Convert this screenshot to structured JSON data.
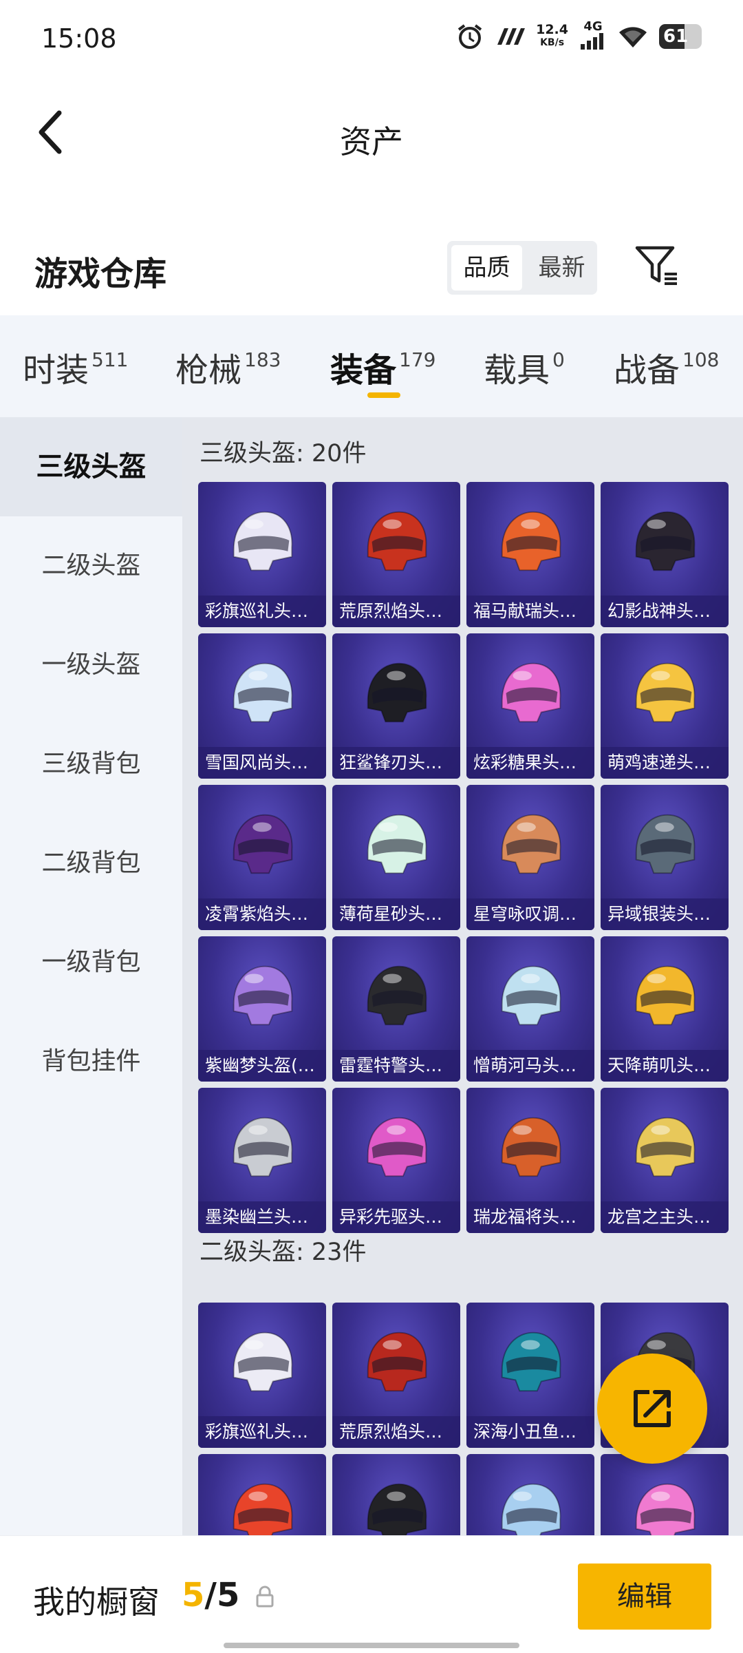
{
  "status_bar": {
    "time": "15:08",
    "speed_value": "12.4",
    "speed_unit": "KB/s",
    "network": "4G",
    "battery": "61"
  },
  "nav": {
    "title": "资产"
  },
  "warehouse": {
    "title": "游戏仓库",
    "sort_quality": "品质",
    "sort_latest": "最新"
  },
  "tabs": [
    {
      "label": "时装",
      "count": "511"
    },
    {
      "label": "枪械",
      "count": "183"
    },
    {
      "label": "装备",
      "count": "179",
      "active": true
    },
    {
      "label": "载具",
      "count": "0"
    },
    {
      "label": "战备",
      "count": "108"
    }
  ],
  "sidebar": {
    "items": [
      {
        "label": "三级头盔",
        "active": true
      },
      {
        "label": "二级头盔"
      },
      {
        "label": "一级头盔"
      },
      {
        "label": "三级背包"
      },
      {
        "label": "二级背包"
      },
      {
        "label": "一级背包"
      },
      {
        "label": "背包挂件"
      }
    ]
  },
  "sections": [
    {
      "title": "三级头盔: 20件",
      "items": [
        {
          "name": "彩旗巡礼头盔...",
          "icon": "white-gold-helmet-icon",
          "color": "#e8e6f5"
        },
        {
          "name": "荒原烈焰头盔...",
          "icon": "red-flame-helmet-icon",
          "color": "#c8321e"
        },
        {
          "name": "福马献瑞头盔...",
          "icon": "orange-horse-helmet-icon",
          "color": "#e8622a"
        },
        {
          "name": "幻影战神头盔...",
          "icon": "black-purple-helmet-icon",
          "color": "#2a2530"
        },
        {
          "name": "雪国风尚头盔...",
          "icon": "snow-helmet-icon",
          "color": "#cfe3f7"
        },
        {
          "name": "狂鲨锋刃头盔...",
          "icon": "shark-helmet-icon",
          "color": "#1e1e24"
        },
        {
          "name": "炫彩糖果头盔...",
          "icon": "candy-helmet-icon",
          "color": "#e86ad0"
        },
        {
          "name": "萌鸡速递头盔...",
          "icon": "chick-helmet-icon",
          "color": "#f5c440"
        },
        {
          "name": "凌霄紫焰头盔...",
          "icon": "purple-flame-helmet-icon",
          "color": "#5a2a8a"
        },
        {
          "name": "薄荷星砂头盔...",
          "icon": "mint-helmet-icon",
          "color": "#d7f2e6"
        },
        {
          "name": "星穹咏叹调头...",
          "icon": "ornate-helmet-icon",
          "color": "#d88a5a"
        },
        {
          "name": "异域银装头盔...",
          "icon": "silver-helmet-icon",
          "color": "#5a6a78"
        },
        {
          "name": "紫幽梦头盔(3...",
          "icon": "violet-dream-helmet-icon",
          "color": "#a27ae0"
        },
        {
          "name": "雷霆特警头盔...",
          "icon": "swat-helmet-icon",
          "color": "#2a2a2e"
        },
        {
          "name": "憎萌河马头盔...",
          "icon": "hippo-helmet-icon",
          "color": "#bfe0f0"
        },
        {
          "name": "天降萌叽头盔...",
          "icon": "yellow-cute-helmet-icon",
          "color": "#f2b72c"
        },
        {
          "name": "墨染幽兰头盔...",
          "icon": "ink-orchid-helmet-icon",
          "color": "#c9ccd2"
        },
        {
          "name": "异彩先驱头盔...",
          "icon": "pink-pioneer-helmet-icon",
          "color": "#e05ac8"
        },
        {
          "name": "瑞龙福将头盔...",
          "icon": "dragon-general-helmet-icon",
          "color": "#d8602a"
        },
        {
          "name": "龙宫之主头盔...",
          "icon": "dragon-palace-helmet-icon",
          "color": "#e8c85a"
        }
      ]
    },
    {
      "title": "二级头盔: 23件",
      "items": [
        {
          "name": "彩旗巡礼头盔...",
          "icon": "white-gold-helmet-icon",
          "color": "#ecebf5"
        },
        {
          "name": "荒原烈焰头盔...",
          "icon": "red-flame-helmet-icon",
          "color": "#b8281e"
        },
        {
          "name": "深海小丑鱼头...",
          "icon": "clownfish-helmet-icon",
          "color": "#1a8aa0"
        },
        {
          "name": "",
          "icon": "dark-helmet-icon",
          "color": "#3a3a3e"
        },
        {
          "name": "",
          "icon": "orange-helmet-icon",
          "color": "#e8442a"
        },
        {
          "name": "",
          "icon": "black-white-helmet-icon",
          "color": "#222226"
        },
        {
          "name": "",
          "icon": "light-blue-helmet-icon",
          "color": "#a8cff0"
        },
        {
          "name": "",
          "icon": "pink-candy-helmet-icon",
          "color": "#f07ad0"
        }
      ]
    }
  ],
  "showcase": {
    "title": "我的橱窗",
    "current": "5",
    "total": "5",
    "edit_label": "编辑"
  }
}
